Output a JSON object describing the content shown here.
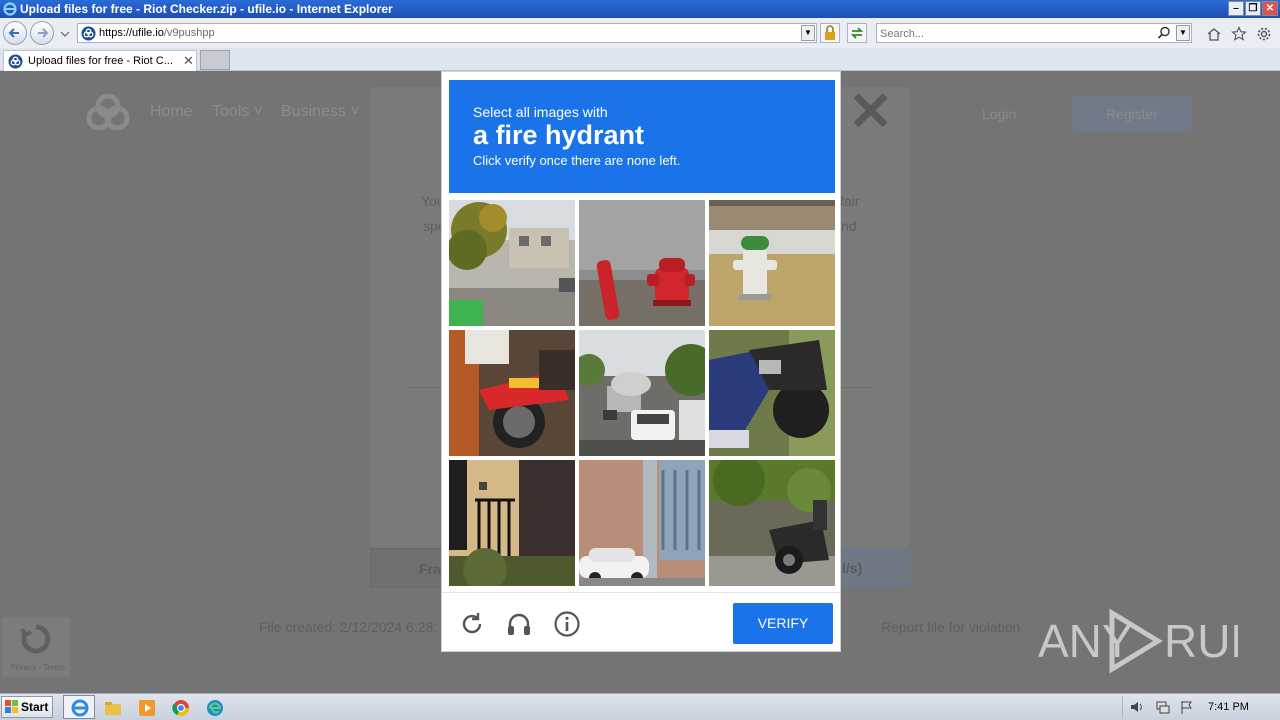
{
  "window": {
    "title": "Upload files for free - Riot Checker.zip - ufile.io - Internet Explorer"
  },
  "address_bar": {
    "url_host": "https://ufile.io",
    "url_path": "/v9pushpp"
  },
  "search_box": {
    "placeholder": "Search..."
  },
  "tabs": [
    {
      "label": "Upload files for free - Riot C..."
    }
  ],
  "site": {
    "nav": {
      "home": "Home",
      "tools": "Tools",
      "business": "Business",
      "login": "Login",
      "register": "Register"
    },
    "modal_text_left_1": "You",
    "modal_text_left_2": "spe",
    "modal_text_right_1": "fair",
    "modal_text_right_2": "nd",
    "free_btn_text": "Fra",
    "premium_btn_text": "l/s)",
    "file_created": "File created: 2/12/2024 6:28:",
    "report_sep": "|",
    "report_link": "Report file for violation",
    "recaptcha_badge_text": "Privacy - Terms"
  },
  "captcha": {
    "instruction_line1": "Select all images with",
    "instruction_target": "a fire hydrant",
    "instruction_line3": "Click verify once there are none left.",
    "verify_label": "VERIFY",
    "tiles": [
      {
        "name": "street-with-trees-tile"
      },
      {
        "name": "red-fire-hydrant-tile"
      },
      {
        "name": "green-white-fire-hydrant-tile"
      },
      {
        "name": "red-motorcycle-tile"
      },
      {
        "name": "cement-truck-street-tile"
      },
      {
        "name": "scooter-rider-tile"
      },
      {
        "name": "building-stairs-railing-tile"
      },
      {
        "name": "building-pole-car-tile"
      },
      {
        "name": "parked-scooter-tile"
      }
    ]
  },
  "watermark": {
    "text": "ANY RUN"
  },
  "taskbar": {
    "start_label": "Start",
    "clock": "7:41 PM"
  }
}
